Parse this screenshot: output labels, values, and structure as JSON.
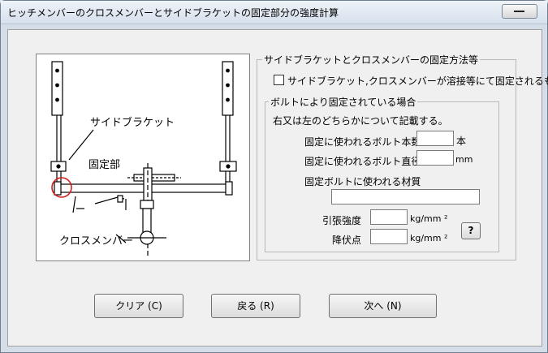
{
  "window": {
    "title": "ヒッチメンバーのクロスメンバーとサイドブラケットの固定部分の強度計算"
  },
  "diagram": {
    "label_side_bracket": "サイドブラケット",
    "label_fixed_part": "固定部",
    "label_cross_member": "クロスメンバー"
  },
  "fixing_method": {
    "legend": "サイドブラケットとクロスメンバーの固定方法等",
    "welded_checkbox_label": "サイドブラケット,クロスメンバーが溶接等にて固定されるもの",
    "welded_checked": false
  },
  "bolt_group": {
    "legend": "ボルトにより固定されている場合",
    "instruction": "右又は左のどちらかについて記載する。",
    "bolt_count_label": "固定に使われるボルト本数",
    "bolt_count_value": "",
    "bolt_count_unit": "本",
    "bolt_diameter_label": "固定に使われるボルト直径",
    "bolt_diameter_value": "",
    "bolt_diameter_unit": "mm",
    "material_label": "固定ボルトに使われる材質",
    "material_value": "",
    "tensile_label": "引張強度",
    "tensile_value": "",
    "tensile_unit": "kg/mm ²",
    "yield_label": "降伏点",
    "yield_value": "",
    "yield_unit": "kg/mm ²",
    "help_label": "?"
  },
  "buttons": {
    "clear": "クリア (C)",
    "back": "戻る (R)",
    "next": "次へ (N)"
  },
  "colors": {
    "highlight_circle": "#d02020"
  }
}
